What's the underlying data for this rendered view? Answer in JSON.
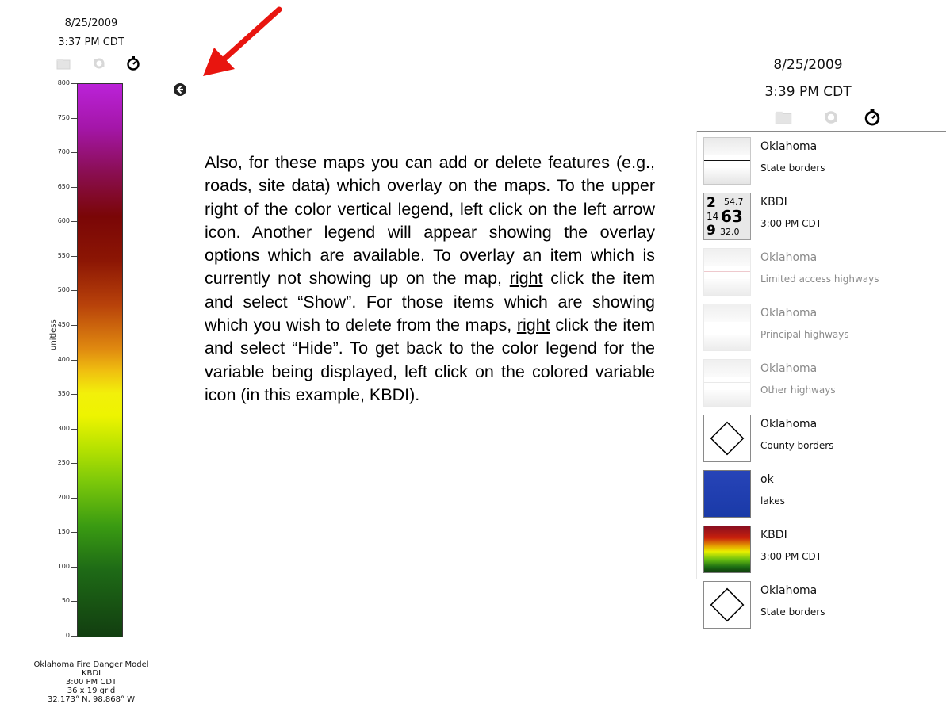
{
  "left_legend": {
    "date": "8/25/2009",
    "time": "3:37 PM CDT",
    "tools": [
      "folder-icon",
      "refresh-icon",
      "timer-icon"
    ],
    "scale_ticks": [
      "800",
      "750",
      "700",
      "650",
      "600",
      "550",
      "500",
      "450",
      "400",
      "350",
      "300",
      "250",
      "200",
      "150",
      "100",
      "50",
      "0"
    ],
    "unit": "unitless",
    "info_lines": [
      "Oklahoma Fire Danger Model",
      "KBDI",
      "3:00 PM CDT",
      "36 x 19 grid",
      "32.173° N, 98.868° W"
    ]
  },
  "instructions": {
    "part1": "Also, for these maps you can add or delete features (e.g., roads, site data) which overlay on the maps.  To the upper right of the color vertical legend, left click on the left arrow icon.  Another legend will appear showing the overlay options which are available.  To overlay an item which is currently not showing up on the map, ",
    "right1": "right",
    "part2": " click the item and select “Show”.   For those items which are showing which you wish to delete from the maps, ",
    "right2": "right",
    "part3": " click the item and select “Hide”.  To get back to the color legend for the variable being displayed, left click on the colored variable icon (in this example, KBDI)."
  },
  "right_legend": {
    "date": "8/25/2009",
    "time": "3:39 PM CDT",
    "tools": [
      "folder-icon",
      "refresh-icon",
      "timer-icon"
    ],
    "items": [
      {
        "title": "Oklahoma",
        "subtitle": "State borders",
        "thumb": "state-borders-line",
        "visible": true
      },
      {
        "title": "KBDI",
        "subtitle": "3:00 PM CDT",
        "thumb": "station-data",
        "visible": true,
        "station": {
          "tl": "2",
          "tr": "54.7",
          "ml": "14",
          "mr": "63",
          "bl": "9",
          "br": "32.0"
        }
      },
      {
        "title": "Oklahoma",
        "subtitle": "Limited access highways",
        "thumb": "highway-line",
        "visible": false
      },
      {
        "title": "Oklahoma",
        "subtitle": "Principal highways",
        "thumb": "highway-line",
        "visible": false
      },
      {
        "title": "Oklahoma",
        "subtitle": "Other highways",
        "thumb": "highway-line",
        "visible": false
      },
      {
        "title": "Oklahoma",
        "subtitle": "County borders",
        "thumb": "diamond",
        "visible": true
      },
      {
        "title": "ok",
        "subtitle": "lakes",
        "thumb": "blue",
        "visible": true
      },
      {
        "title": "KBDI",
        "subtitle": "3:00 PM CDT",
        "thumb": "kbdi-gradient",
        "visible": true
      },
      {
        "title": "Oklahoma",
        "subtitle": "State borders",
        "thumb": "diamond",
        "visible": true
      }
    ]
  },
  "colors": {
    "annotation_arrow": "#e8150f",
    "limited_highway_line": "#e7b3b8",
    "other_highway_line": "#e0e0e0"
  }
}
